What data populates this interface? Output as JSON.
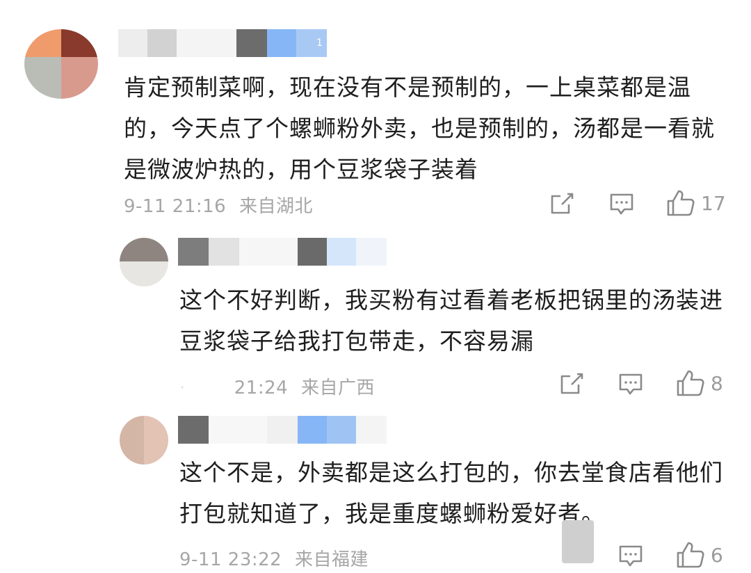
{
  "comments": [
    {
      "reply_badge": "1",
      "text": "肯定预制菜啊，现在没有不是预制的，一上桌菜都是温的，今天点了个螺蛳粉外卖，也是预制的，汤都是一看就是微波炉热的，用个豆浆袋子装着",
      "time": "9-11 21:16",
      "location": "来自湖北",
      "like_count": "17"
    },
    {
      "text": "这个不好判断，我买粉有过看着老板把锅里的汤装进豆浆袋子给我打包带走，不容易漏",
      "time": "21:24",
      "location": "来自广西",
      "like_count": "8"
    },
    {
      "text": "这个不是，外卖都是这么打包的，你去堂食店看他们打包就知道了，我是重度螺蛳粉爱好者。",
      "time": "9-11 23:22",
      "location": "来自福建",
      "like_count": "6"
    }
  ],
  "icons": {
    "share": "share-external-icon",
    "reply": "comment-bubble-icon",
    "like": "thumbs-up-icon"
  },
  "colors": {
    "text": "#1e1e1e",
    "meta": "#a6a6a6",
    "icon": "#8a8a8a",
    "blur_blue": "#86b6f5"
  }
}
